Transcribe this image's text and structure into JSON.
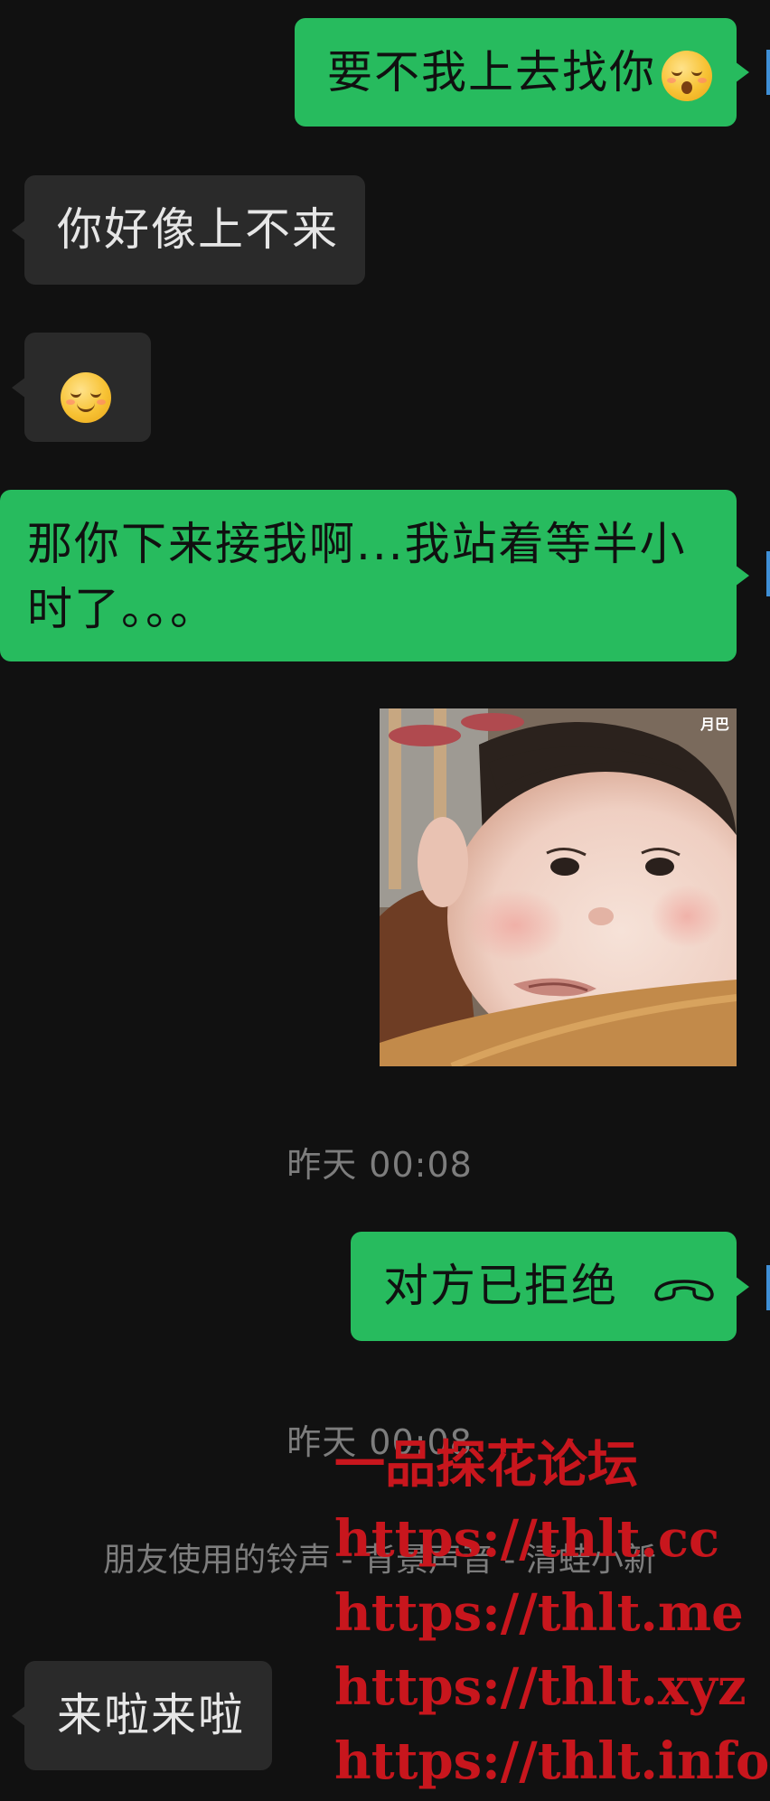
{
  "messages": [
    {
      "side": "out",
      "text": "要不我上去找你",
      "emoji": "kissing-face-emoji"
    },
    {
      "side": "in",
      "text": "你好像上不来"
    },
    {
      "side": "in",
      "text": "",
      "emoji": "relieved-face-emoji"
    },
    {
      "side": "out",
      "text": "那你下来接我啊...我站着等半小时了。。。"
    },
    {
      "side": "out",
      "type": "image",
      "corner_text": "月巴"
    },
    {
      "type": "timestamp",
      "text": "昨天 00:08"
    },
    {
      "side": "out",
      "text": "对方已拒绝",
      "icon": "phone-hangup-icon"
    },
    {
      "type": "timestamp",
      "text": "昨天 00:08"
    },
    {
      "type": "system",
      "text": "朋友使用的铃声 - 背景声音 - 清蛙小新"
    },
    {
      "side": "in",
      "text": "来啦来啦"
    }
  ],
  "watermark": {
    "lines": [
      "一品探花论坛",
      "https://thlt.cc",
      "https://thlt.me",
      "https://thlt.xyz",
      "https://thlt.info"
    ]
  },
  "colors": {
    "background": "#111111",
    "outgoing_bubble": "#27bb5e",
    "incoming_bubble": "#2a2a2a",
    "timestamp_text": "#7d7d7d",
    "watermark": "#c8161d"
  }
}
